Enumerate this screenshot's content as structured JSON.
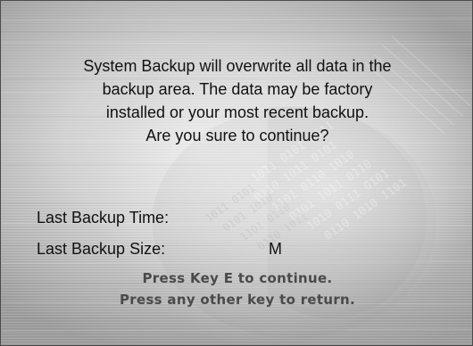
{
  "dialog": {
    "message_lines": [
      "System Backup will overwrite all data in the",
      "backup area. The data may be factory",
      "installed or your most recent backup.",
      "Are you sure to continue?"
    ],
    "last_backup_time_label": "Last Backup Time:",
    "last_backup_size_label": "Last Backup Size:",
    "last_backup_size_value": "M",
    "prompt_continue": "Press Key E to continue.",
    "prompt_return": "Press any other key to return."
  },
  "watermark": {
    "digits": "10110101011101010110",
    "icon": "binary-data-watermark-icon"
  },
  "colors": {
    "text": "#111111",
    "prompt_text": "#4a4a4a",
    "background_light": "#e9e9e9",
    "background_dark": "#9d9d9d"
  }
}
